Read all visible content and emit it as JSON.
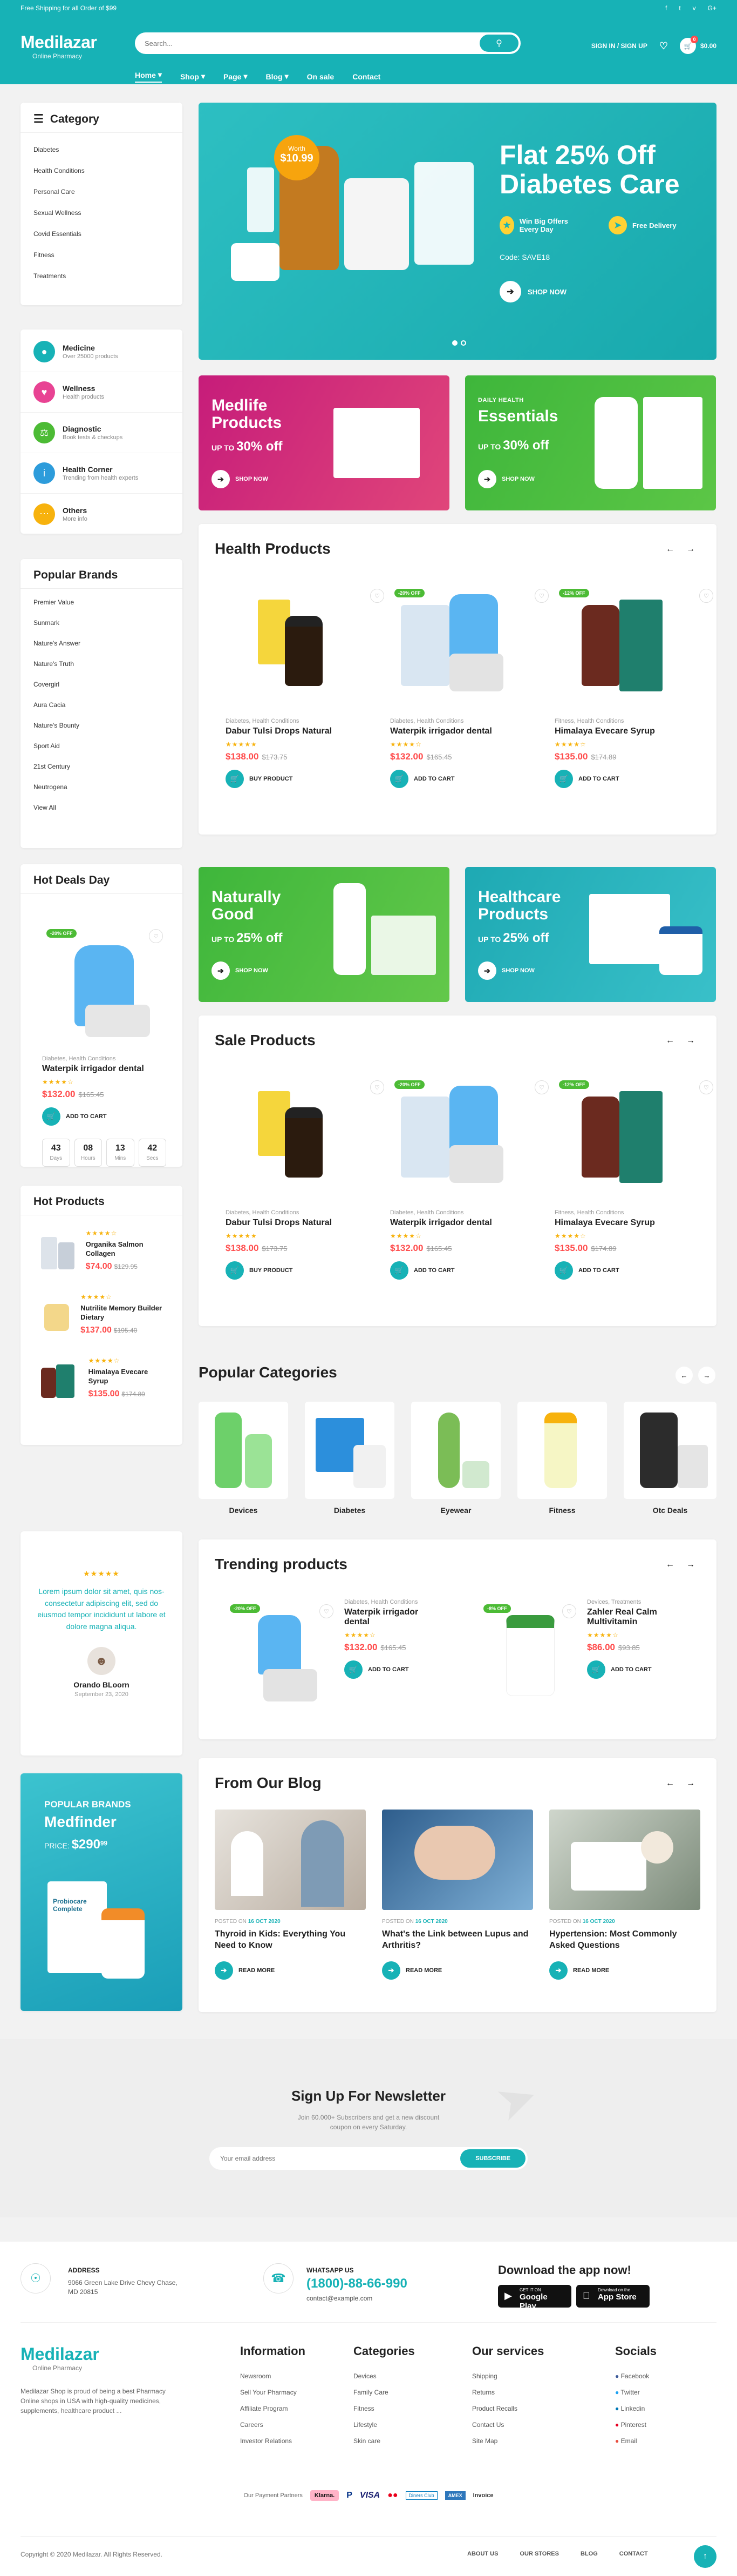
{
  "topbar": {
    "text": "Free Shipping for all Order of $99",
    "social": [
      "f-icon",
      "t-icon",
      "v-icon",
      "g-icon"
    ]
  },
  "header": {
    "logo": "Medilazar",
    "logo_sub": "Online Pharmacy",
    "search_placeholder": "Search...",
    "signin": "SIGN IN / SIGN UP",
    "cart_count": "0",
    "cart_total": "$0.00",
    "nav": [
      "Home",
      "Shop",
      "Page",
      "Blog",
      "On sale",
      "Contact"
    ]
  },
  "category": {
    "title": "Category",
    "items": [
      "Diabetes",
      "Health Conditions",
      "Personal Care",
      "Sexual Wellness",
      "Covid Essentials",
      "Fitness",
      "Treatments"
    ]
  },
  "services": [
    {
      "t": "Medicine",
      "d": "Over 25000 products",
      "color": "#17b2b6"
    },
    {
      "t": "Wellness",
      "d": "Health products",
      "color": "#e84393"
    },
    {
      "t": "Diagnostic",
      "d": "Book tests & checkups",
      "color": "#4cbb35"
    },
    {
      "t": "Health Corner",
      "d": "Trending from health experts",
      "color": "#2d9cdb"
    },
    {
      "t": "Others",
      "d": "More info",
      "color": "#f7b20d"
    }
  ],
  "brands": {
    "title": "Popular Brands",
    "items": [
      "Premier Value",
      "Sunmark",
      "Nature's Answer",
      "Nature's Truth",
      "Covergirl",
      "Aura Cacia",
      "Nature's Bounty",
      "Sport Aid",
      "21st Century",
      "Neutrogena",
      "View All"
    ]
  },
  "hero": {
    "badge_top": "Worth",
    "badge_price": "$10.99",
    "line1": "Flat 25% Off",
    "line2": "Diabetes Care",
    "perk1": "Win Big Offers Every Day",
    "perk2": "Free Delivery",
    "code": "Code: SAVE18",
    "shop": "SHOP NOW"
  },
  "promo1": {
    "t1": "Medlife",
    "t2": "Products",
    "up": "UP TO",
    "pct": "30% off",
    "shop": "SHOP NOW"
  },
  "promo2": {
    "k": "DAILY HEALTH",
    "t": "Essentials",
    "up": "UP TO",
    "pct": "30% off",
    "shop": "SHOP NOW"
  },
  "promo3": {
    "t1": "Naturally",
    "t2": "Good",
    "up": "UP TO",
    "pct": "25% off",
    "shop": "SHOP NOW"
  },
  "promo4": {
    "t1": "Healthcare",
    "t2": "Products",
    "up": "UP TO",
    "pct": "25% off",
    "shop": "SHOP NOW"
  },
  "health": {
    "title": "Health Products",
    "products": [
      {
        "cat": "Diabetes, Health Conditions",
        "name": "Dabur Tulsi Drops Natural",
        "price": "$138.00",
        "old": "$173.75",
        "btn": "BUY PRODUCT",
        "badge": ""
      },
      {
        "cat": "Diabetes, Health Conditions",
        "name": "Waterpik irrigador dental",
        "price": "$132.00",
        "old": "$165.45",
        "btn": "ADD TO CART",
        "badge": "-20% OFF"
      },
      {
        "cat": "Fitness, Health Conditions",
        "name": "Himalaya Evecare Syrup",
        "price": "$135.00",
        "old": "$174.89",
        "btn": "ADD TO CART",
        "badge": "-12% OFF"
      }
    ]
  },
  "hotdeal": {
    "title": "Hot Deals Day",
    "badge": "-20% OFF",
    "cat": "Diabetes, Health Conditions",
    "name": "Waterpik irrigador dental",
    "price": "$132.00",
    "old": "$165.45",
    "btn": "ADD TO CART",
    "cd": [
      {
        "v": "43",
        "l": "Days"
      },
      {
        "v": "08",
        "l": "Hours"
      },
      {
        "v": "13",
        "l": "Mins"
      },
      {
        "v": "42",
        "l": "Secs"
      }
    ]
  },
  "sale": {
    "title": "Sale Products",
    "products": [
      {
        "cat": "Diabetes, Health Conditions",
        "name": "Dabur Tulsi Drops Natural",
        "price": "$138.00",
        "old": "$173.75",
        "btn": "BUY PRODUCT",
        "badge": ""
      },
      {
        "cat": "Diabetes, Health Conditions",
        "name": "Waterpik irrigador dental",
        "price": "$132.00",
        "old": "$165.45",
        "btn": "ADD TO CART",
        "badge": "-20% OFF"
      },
      {
        "cat": "Fitness, Health Conditions",
        "name": "Himalaya Evecare Syrup",
        "price": "$135.00",
        "old": "$174.89",
        "btn": "ADD TO CART",
        "badge": "-12% OFF"
      }
    ]
  },
  "hot": {
    "title": "Hot Products",
    "items": [
      {
        "name": "Organika Salmon Collagen",
        "price": "$74.00",
        "old": "$129.95"
      },
      {
        "name": "Nutrilite Memory Builder Dietary",
        "price": "$137.00",
        "old": "$195.40"
      },
      {
        "name": "Himalaya Evecare Syrup",
        "price": "$135.00",
        "old": "$174.89"
      }
    ]
  },
  "categories": {
    "title": "Popular Categories",
    "items": [
      "Devices",
      "Diabetes",
      "Eyewear",
      "Fitness",
      "Otc Deals"
    ]
  },
  "testimonial": {
    "text": "Lorem ipsum dolor sit amet, quis nos- consectetur adipiscing elit, sed do eiusmod tempor incididunt ut labore et dolore magna aliqua.",
    "name": "Orando BLoorn",
    "date": "September 23, 2020"
  },
  "trending": {
    "title": "Trending products",
    "items": [
      {
        "cat": "Diabetes, Health Conditions",
        "name": "Waterpik irrigador dental",
        "price": "$132.00",
        "old": "$165.45",
        "btn": "ADD TO CART",
        "badge": "-20% OFF"
      },
      {
        "cat": "Devices, Treatments",
        "name": "Zahler Real Calm Multivitamin",
        "price": "$86.00",
        "old": "$93.85",
        "btn": "ADD TO CART",
        "badge": "-8% OFF"
      }
    ]
  },
  "medfinder": {
    "k": "POPULAR BRANDS",
    "t": "Medfinder",
    "price_label": "PRICE:",
    "price": "$290",
    "cents": "99",
    "box_label": "Probiocare Complete"
  },
  "blog": {
    "title": "From Our Blog",
    "posts": [
      {
        "date_label": "POSTED ON",
        "date": "16 OCT 2020",
        "title": "Thyroid in Kids: Everything You Need to Know",
        "more": "READ MORE"
      },
      {
        "date_label": "POSTED ON",
        "date": "16 OCT 2020",
        "title": "What's the Link between Lupus and Arthritis?",
        "more": "READ MORE"
      },
      {
        "date_label": "POSTED ON",
        "date": "16 OCT 2020",
        "title": "Hypertension: Most Commonly Asked Questions",
        "more": "READ MORE"
      }
    ]
  },
  "newsletter": {
    "title": "Sign Up For Newsletter",
    "desc": "Join 60.000+ Subscribers and get a new discount coupon on every Saturday.",
    "placeholder": "Your email address",
    "btn": "SUBSCRIBE"
  },
  "contact": {
    "addr_label": "ADDRESS",
    "addr": "9066 Green Lake Drive Chevy Chase, MD 20815",
    "wa_label": "WHATSAPP US",
    "phone": "(1800)-88-66-990",
    "email": "contact@example.com",
    "app_title": "Download the app now!",
    "gp_small": "GET IT ON",
    "gp": "Google Play",
    "as_small": "Download on the",
    "as": "App Store"
  },
  "footer": {
    "about": "Medilazar Shop is proud of being a best Pharmacy Online shops in USA with high-quality medicines, supplements, healthcare product ...",
    "info": {
      "title": "Information",
      "items": [
        "Newsroom",
        "Sell Your Pharmacy",
        "Affiliate Program",
        "Careers",
        "Investor Relations"
      ]
    },
    "cats": {
      "title": "Categories",
      "items": [
        "Devices",
        "Family Care",
        "Fitness",
        "Lifestyle",
        "Skin care"
      ]
    },
    "services": {
      "title": "Our services",
      "items": [
        "Shipping",
        "Returns",
        "Product Recalls",
        "Contact Us",
        "Site Map"
      ]
    },
    "socials": {
      "title": "Socials",
      "items": [
        "Facebook",
        "Twitter",
        "Linkedin",
        "Pinterest",
        "Email"
      ]
    },
    "pay_label": "Our Payment Partners",
    "pay": [
      "Klarna.",
      "P",
      "VISA",
      "●●",
      "Diners Club",
      "AMEX",
      "Invoice"
    ],
    "copy": "Copyright © 2020 Medilazar. All Rights Reserved.",
    "links": [
      "ABOUT US",
      "OUR STORES",
      "BLOG",
      "CONTACT"
    ]
  }
}
